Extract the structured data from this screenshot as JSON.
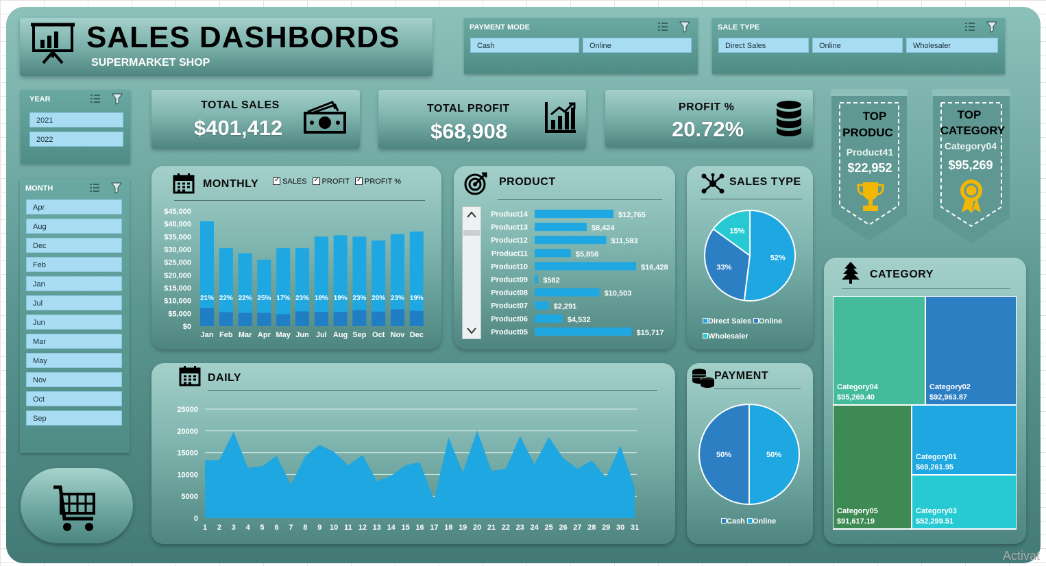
{
  "header": {
    "title": "SALES DASHBORDS",
    "subtitle": "SUPERMARKET SHOP"
  },
  "payment_mode_slicer": {
    "title": "PAYMENT MODE",
    "options": [
      "Cash",
      "Online"
    ]
  },
  "sale_type_slicer": {
    "title": "SALE TYPE",
    "options": [
      "Direct Sales",
      "Online",
      "Wholesaler"
    ]
  },
  "year_slicer": {
    "title": "YEAR",
    "options": [
      "2021",
      "2022"
    ]
  },
  "month_slicer": {
    "title": "MONTH",
    "options": [
      "Apr",
      "Aug",
      "Dec",
      "Feb",
      "Jan",
      "Jul",
      "Jun",
      "Mar",
      "May",
      "Nov",
      "Oct",
      "Sep"
    ]
  },
  "kpis": {
    "total_sales_label": "TOTAL SALES",
    "total_sales_value": "$401,412",
    "total_profit_label": "TOTAL PROFIT",
    "total_profit_value": "$68,908",
    "profit_pct_label": "PROFIT %",
    "profit_pct_value": "20.72%"
  },
  "top_product": {
    "title_line1": "TOP",
    "title_line2": "PRODUC",
    "name": "Product41",
    "value": "$22,952"
  },
  "top_category": {
    "title_line1": "TOP",
    "title_line2": "CATEGORY",
    "name": "Category04",
    "value": "$95,269"
  },
  "monthly": {
    "title": "MONTHLY",
    "legend": [
      "SALES",
      "PROFIT",
      "PROFIT %"
    ]
  },
  "product": {
    "title": "PRODUCT"
  },
  "sales_type": {
    "title": "SALES TYPE",
    "legend": [
      "Direct Sales",
      "Online",
      "Wholesaler"
    ]
  },
  "daily": {
    "title": "DAILY"
  },
  "payment": {
    "title": "PAYMENT",
    "legend": [
      "Cash",
      "Online"
    ]
  },
  "category": {
    "title": "CATEGORY"
  },
  "colors": {
    "bar_sales": "#1ea7e1",
    "bar_profit": "#1f7ec4",
    "teal": "#44bb9a",
    "blue_dark": "#2c7fc3",
    "green": "#3e8a55",
    "cyan": "#27cad3"
  },
  "chart_data": [
    {
      "type": "bar",
      "name": "MONTHLY",
      "categories": [
        "Jan",
        "Feb",
        "Mar",
        "Apr",
        "May",
        "Jun",
        "Jul",
        "Aug",
        "Sep",
        "Oct",
        "Nov",
        "Dec"
      ],
      "series": [
        {
          "name": "SALES",
          "values": [
            41000,
            30500,
            28500,
            26000,
            30500,
            30500,
            35000,
            35500,
            35000,
            33500,
            36000,
            37000
          ]
        },
        {
          "name": "PROFIT",
          "values": [
            7000,
            5500,
            5200,
            5200,
            4700,
            5800,
            5600,
            5600,
            6300,
            5700,
            6600,
            6000
          ]
        }
      ],
      "data_labels": [
        "21%",
        "22%",
        "22%",
        "25%",
        "17%",
        "23%",
        "18%",
        "19%",
        "23%",
        "20%",
        "23%",
        "19%"
      ],
      "y_ticks": [
        "$0",
        "$5,000",
        "$10,000",
        "$15,000",
        "$20,000",
        "$25,000",
        "$30,000",
        "$35,000",
        "$40,000",
        "$45,000"
      ],
      "ylim": [
        0,
        45000
      ]
    },
    {
      "type": "bar",
      "name": "PRODUCT",
      "categories": [
        "Product14",
        "Product13",
        "Product12",
        "Product11",
        "Product10",
        "Product09",
        "Product08",
        "Product07",
        "Product06",
        "Product05"
      ],
      "values": [
        12765,
        8424,
        11583,
        5856,
        16428,
        582,
        10503,
        2291,
        4532,
        15717
      ],
      "data_labels": [
        "$12,765",
        "$8,424",
        "$11,583",
        "$5,856",
        "$16,428",
        "$582",
        "$10,503",
        "$2,291",
        "$4,532",
        "$15,717"
      ]
    },
    {
      "type": "pie",
      "name": "SALES TYPE",
      "labels": [
        "Direct Sales",
        "Online",
        "Wholesaler"
      ],
      "values": [
        52,
        33,
        15
      ],
      "data_labels": [
        "52%",
        "33%",
        "15%"
      ]
    },
    {
      "type": "area",
      "name": "DAILY",
      "x": [
        1,
        2,
        3,
        4,
        5,
        6,
        7,
        8,
        9,
        10,
        11,
        12,
        13,
        14,
        15,
        16,
        17,
        18,
        19,
        20,
        21,
        22,
        23,
        24,
        25,
        26,
        27,
        28,
        29,
        30,
        31
      ],
      "values": [
        13200,
        13300,
        19800,
        11500,
        11900,
        14300,
        7600,
        14200,
        16800,
        15200,
        12100,
        14500,
        8400,
        9700,
        12100,
        12800,
        4100,
        18500,
        10500,
        20100,
        10800,
        11300,
        18800,
        12300,
        18600,
        13800,
        11300,
        13200,
        9300,
        16600,
        7100
      ],
      "y_ticks": [
        "0",
        "5000",
        "10000",
        "15000",
        "20000",
        "25000"
      ],
      "ylim": [
        0,
        25000
      ]
    },
    {
      "type": "pie",
      "name": "PAYMENT",
      "labels": [
        "Cash",
        "Online"
      ],
      "values": [
        50,
        50
      ],
      "data_labels": [
        "50%",
        "50%"
      ]
    },
    {
      "type": "treemap",
      "name": "CATEGORY",
      "labels": [
        "Category04",
        "Category02",
        "Category05",
        "Category01",
        "Category03"
      ],
      "values": [
        95269.4,
        92963.87,
        91617.19,
        69261.95,
        52299.51
      ],
      "data_labels": [
        "$95,269.40",
        "$92,963.87",
        "$91,617.19",
        "$69,261.95",
        "$52,299.51"
      ]
    }
  ],
  "watermark": "Activat"
}
